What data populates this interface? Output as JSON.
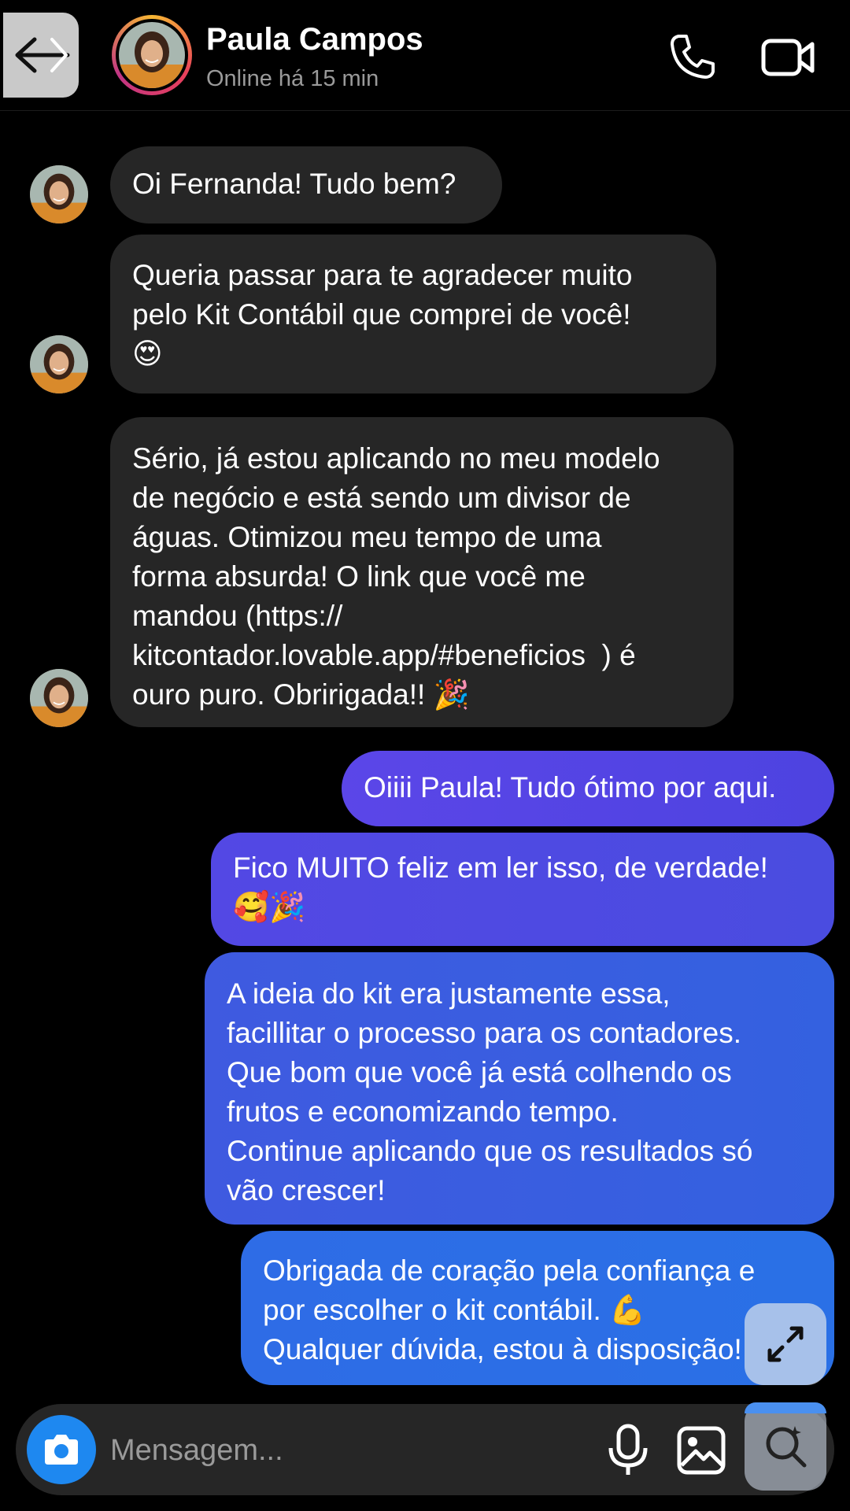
{
  "header": {
    "title": "Paula Campos",
    "subtitle": "Online há 15 min"
  },
  "messages": [
    {
      "direction": "incoming",
      "text": "Oi Fernanda! Tudo bem?"
    },
    {
      "direction": "incoming",
      "text": "Queria passar para te agradecer muito\npelo Kit Contábil que comprei de você!\n😍"
    },
    {
      "direction": "incoming",
      "text": "Sério, já estou aplicando no meu modelo\nde negócio e está sendo um divisor de\náguas. Otimizou meu tempo de uma\nforma absurda! O link que você me\nmandou (https://\nkitcontador.lovable.app/#beneficios  ) é\nouro puro. Obririgada!! 🎉"
    },
    {
      "direction": "outgoing",
      "text": "Oiiii Paula! Tudo ótimo por aqui."
    },
    {
      "direction": "outgoing",
      "text": "Fico MUITO feliz em ler isso, de verdade!\n🥰🎉"
    },
    {
      "direction": "outgoing",
      "text": "A ideia do kit era justamente essa,\nfacillitar o processo para os contadores.\nQue bom que você já está colhendo os\nfrutos e economizando tempo.\nContinue aplicando que os resultados só\nvão crescer!"
    },
    {
      "direction": "outgoing",
      "text": "Obrigada de coração pela confiança e\npor escolher o kit contábil. 💪\nQualquer dúvida, estou à disposição!"
    }
  ],
  "composer": {
    "placeholder": "Mensagem..."
  },
  "colors": {
    "background": "#000000",
    "incoming_bubble": "#262626",
    "outgoing_top": "#5b46e8",
    "outgoing_bottom": "#2a70e6",
    "camera_button": "#1e88f0"
  },
  "icons": [
    "back-arrow-icon",
    "phone-icon",
    "video-camera-icon",
    "expand-icon",
    "camera-icon",
    "microphone-icon",
    "image-icon",
    "sticker-search-icon"
  ]
}
